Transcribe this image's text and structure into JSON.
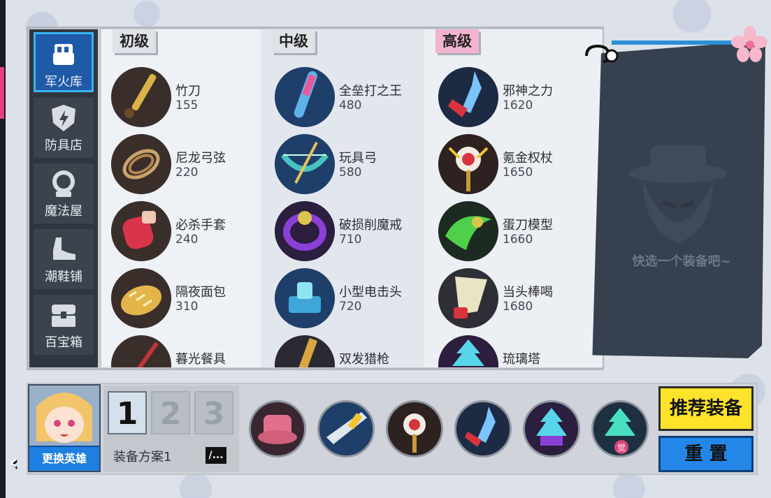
{
  "categories": [
    {
      "label": "军火库",
      "icon": "fist-icon",
      "active": true
    },
    {
      "label": "防具店",
      "icon": "shield-icon",
      "active": false
    },
    {
      "label": "魔法屋",
      "icon": "crystal-ball-icon",
      "active": false
    },
    {
      "label": "潮鞋铺",
      "icon": "shoe-icon",
      "active": false
    },
    {
      "label": "百宝箱",
      "icon": "chest-icon",
      "active": false
    }
  ],
  "tiers": {
    "basic": {
      "label": "初级",
      "items": [
        {
          "name": "竹刀",
          "price": "155",
          "icon": "bamboo-sword-icon"
        },
        {
          "name": "尼龙弓弦",
          "price": "220",
          "icon": "bowstring-icon"
        },
        {
          "name": "必杀手套",
          "price": "240",
          "icon": "boxing-glove-icon"
        },
        {
          "name": "隔夜面包",
          "price": "310",
          "icon": "bread-icon"
        },
        {
          "name": "暮光餐具",
          "price": "",
          "icon": "cutlery-icon"
        }
      ]
    },
    "mid": {
      "label": "中级",
      "items": [
        {
          "name": "全垒打之王",
          "price": "480",
          "icon": "baseball-bat-icon"
        },
        {
          "name": "玩具弓",
          "price": "580",
          "icon": "toy-bow-icon"
        },
        {
          "name": "破损削魔戒",
          "price": "710",
          "icon": "ring-icon"
        },
        {
          "name": "小型电击头",
          "price": "720",
          "icon": "stun-head-icon"
        },
        {
          "name": "双发猎枪",
          "price": "",
          "icon": "shotgun-icon"
        }
      ]
    },
    "high": {
      "label": "高级",
      "items": [
        {
          "name": "邪神之力",
          "price": "1620",
          "icon": "evil-spear-icon"
        },
        {
          "name": "氪金权杖",
          "price": "1650",
          "icon": "scepter-icon"
        },
        {
          "name": "蛋刀模型",
          "price": "1660",
          "icon": "green-blade-icon"
        },
        {
          "name": "当头棒喝",
          "price": "1680",
          "icon": "paper-fan-icon"
        },
        {
          "name": "琉璃塔",
          "price": "",
          "icon": "glass-tower-icon"
        }
      ]
    }
  },
  "preview": {
    "hint": "快选一个装备吧~"
  },
  "hero": {
    "change_label": "更换英雄"
  },
  "loadout": {
    "slots": [
      "1",
      "2",
      "3"
    ],
    "active_slot": "1",
    "name": "装备方案1",
    "edit_label": "/..."
  },
  "equipped": [
    {
      "icon": "pink-hat-icon"
    },
    {
      "icon": "blue-blade-icon"
    },
    {
      "icon": "scepter-icon"
    },
    {
      "icon": "evil-spear-icon"
    },
    {
      "icon": "glass-tower-icon"
    },
    {
      "icon": "awakened-tower-icon",
      "badge": "觉"
    }
  ],
  "buttons": {
    "recommend": "推荐装备",
    "reset": "重 置"
  },
  "colors": {
    "active_category": "#1f5aa7",
    "recommend_button": "#ffe32a",
    "reset_button": "#2387e8",
    "high_tier_tag": "#f3b4cf"
  }
}
